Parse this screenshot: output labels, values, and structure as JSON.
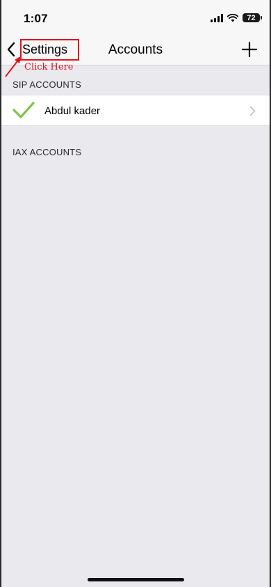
{
  "status_bar": {
    "time": "1:07",
    "battery": "72",
    "icons": [
      "cellular-signal-icon",
      "wifi-icon",
      "battery-icon"
    ]
  },
  "nav": {
    "back_label": "Settings",
    "title": "Accounts",
    "icons": {
      "back": "chevron-left-icon",
      "add": "plus-icon"
    }
  },
  "annotation": {
    "text": "Click Here",
    "color": "#e0141a"
  },
  "sections": {
    "sip": {
      "header": "SIP ACCOUNTS",
      "accounts": [
        {
          "name": "Abdul kader",
          "status_icon": "checkmark-icon",
          "status_color": "#7cc44a"
        }
      ]
    },
    "iax": {
      "header": "IAX ACCOUNTS"
    }
  }
}
